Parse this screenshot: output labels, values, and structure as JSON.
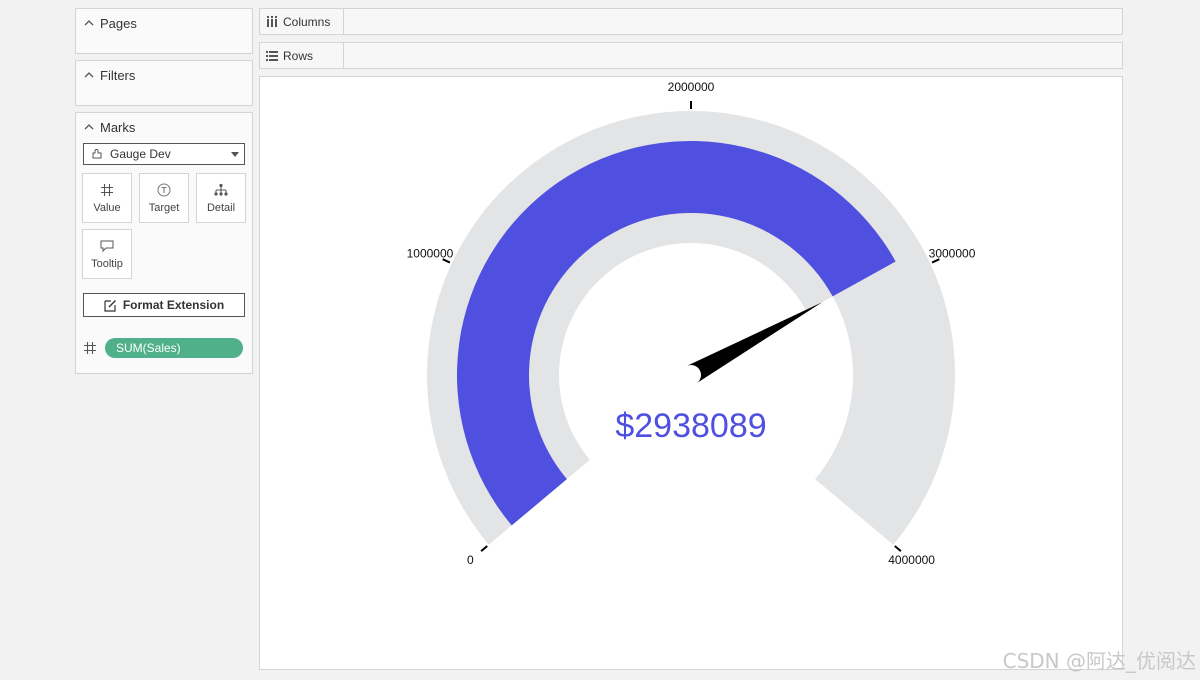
{
  "left_panel": {
    "pages_label": "Pages",
    "filters_label": "Filters",
    "marks_label": "Marks",
    "mark_type": "Gauge Dev",
    "encodings": [
      {
        "label": "Value",
        "icon": "hash-icon"
      },
      {
        "label": "Target",
        "icon": "target-icon"
      },
      {
        "label": "Detail",
        "icon": "hierarchy-icon"
      },
      {
        "label": "Tooltip",
        "icon": "speech-bubble-icon"
      }
    ],
    "format_extension_label": "Format Extension",
    "field_pill": "SUM(Sales)",
    "pill_color": "#4fb08a"
  },
  "shelves": {
    "columns_label": "Columns",
    "rows_label": "Rows"
  },
  "gauge": {
    "value": 2938089,
    "value_label": "$2938089",
    "min": 0,
    "max": 4000000,
    "ticks": [
      {
        "value": 0,
        "label": "0"
      },
      {
        "value": 1000000,
        "label": "1000000"
      },
      {
        "value": 2000000,
        "label": "2000000"
      },
      {
        "value": 3000000,
        "label": "3000000"
      },
      {
        "value": 4000000,
        "label": "4000000"
      }
    ],
    "fill_color": "#4f50e0",
    "track_color": "#e3e4e6",
    "needle_color": "#000000",
    "value_color": "#4f50e0"
  },
  "watermark": "CSDN @阿达_优阅达"
}
